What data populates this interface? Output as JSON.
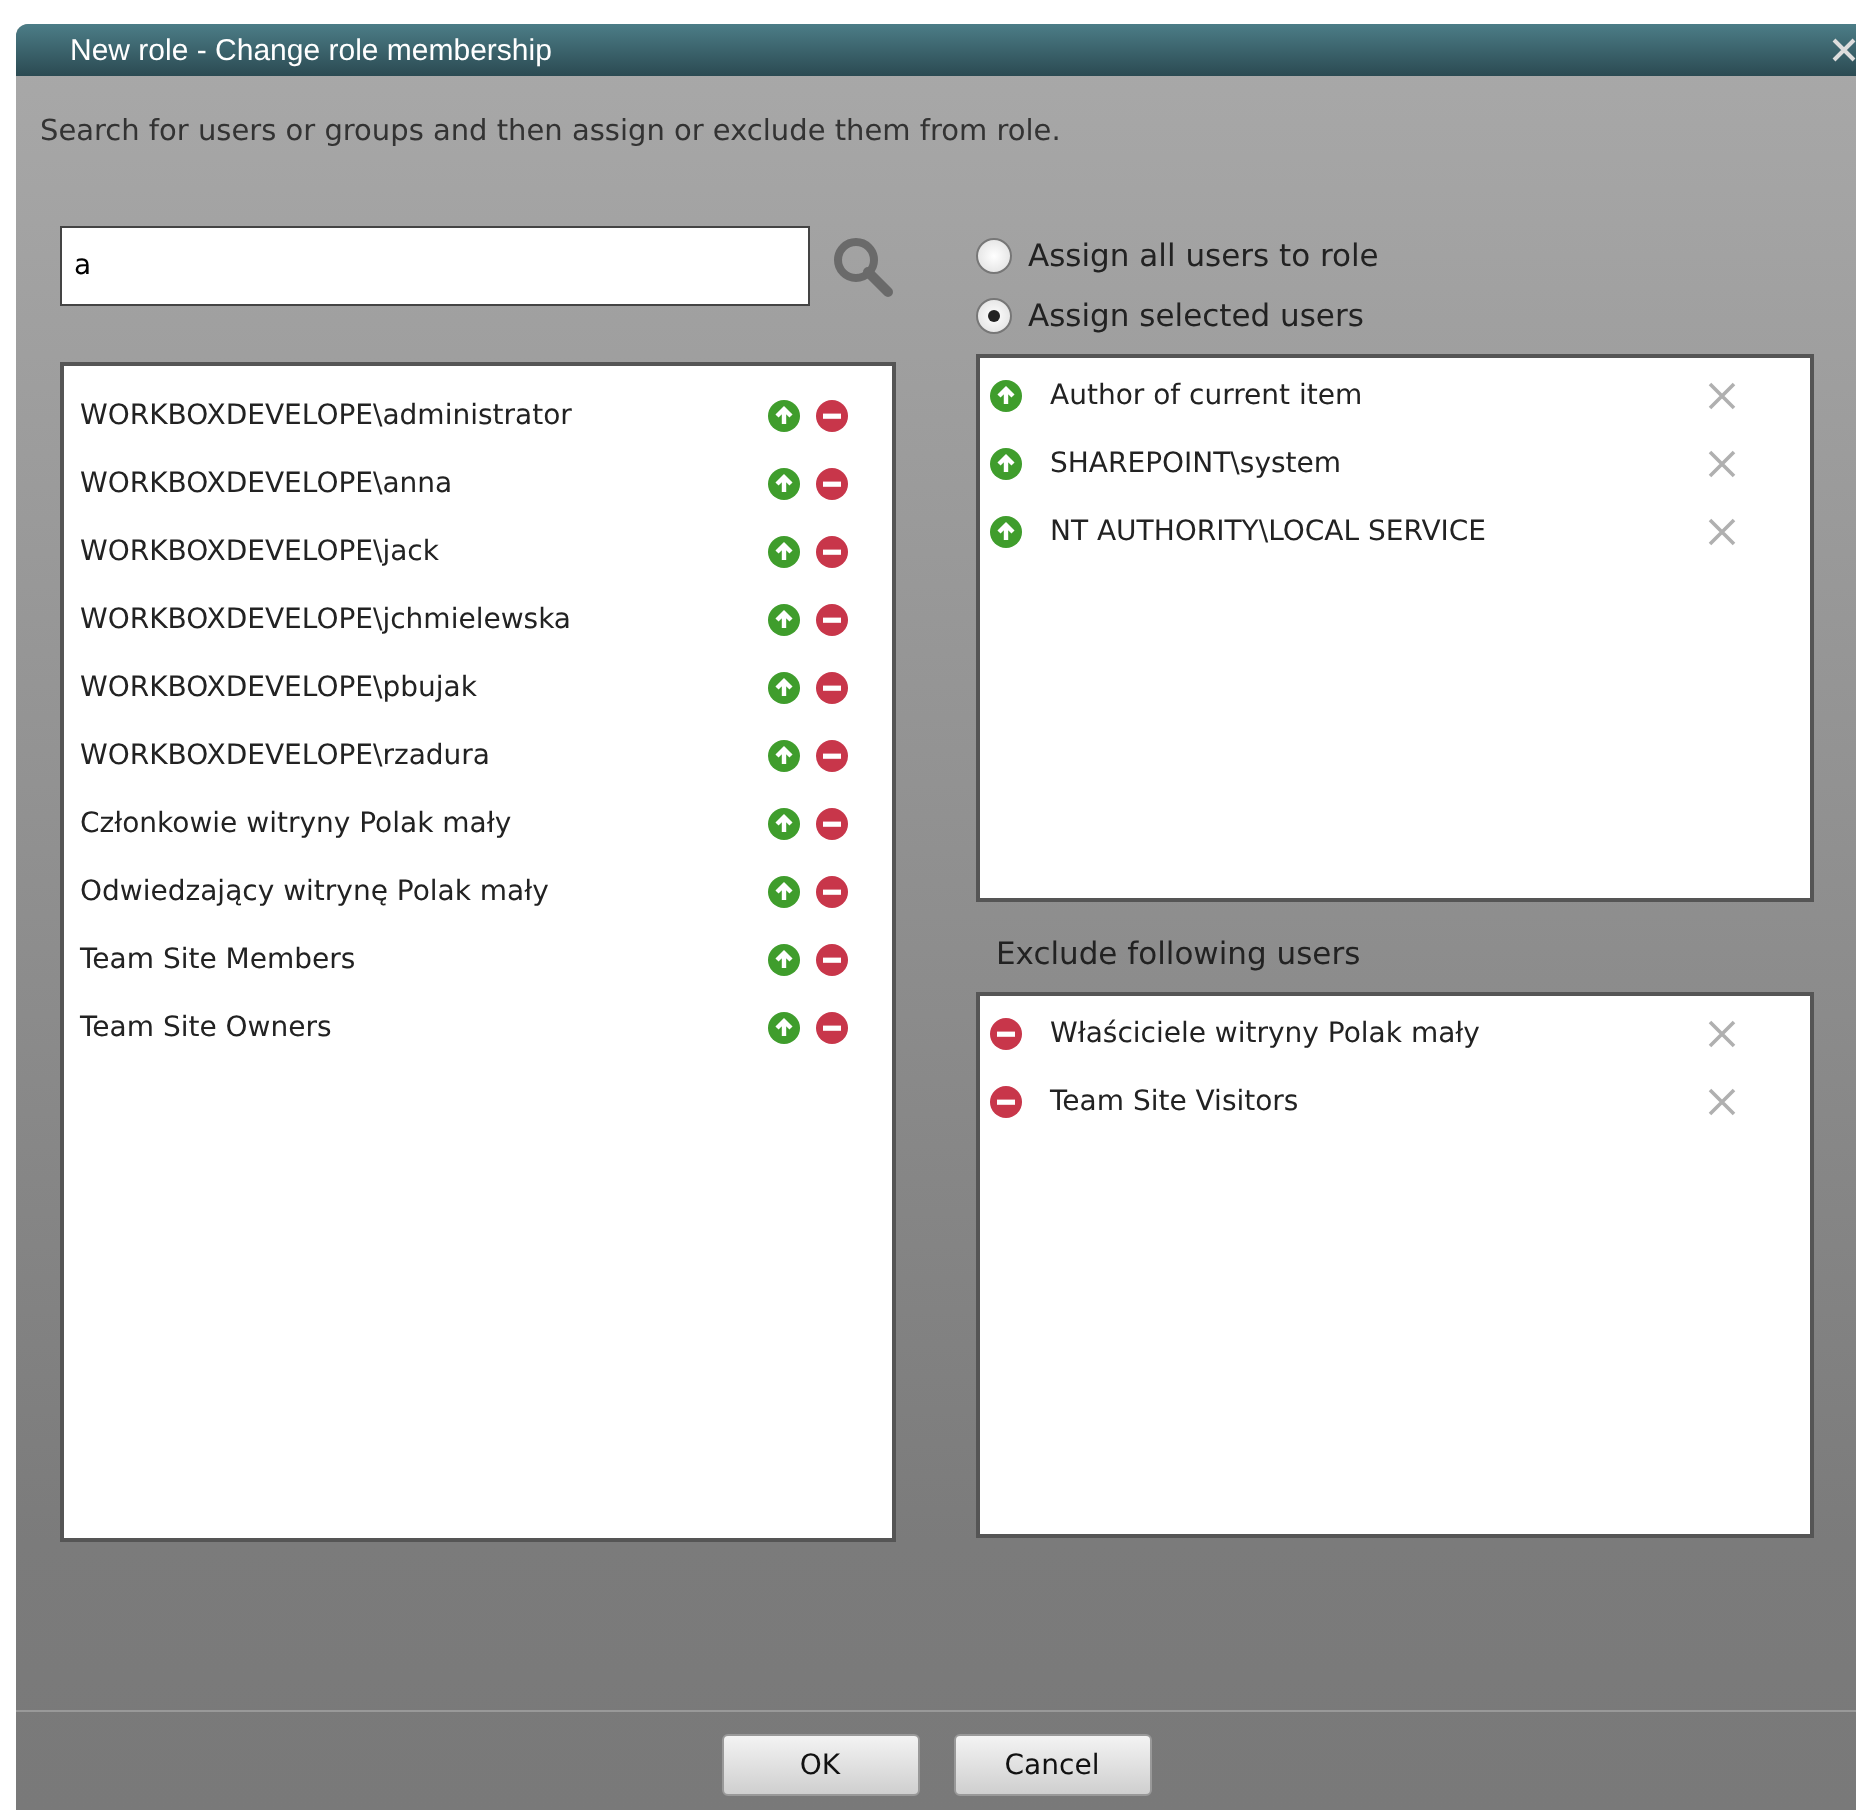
{
  "window": {
    "title": "New role - Change role membership"
  },
  "description": "Search for users or groups and then assign or exclude them from role.",
  "search": {
    "value": "a"
  },
  "results": [
    {
      "name": "WORKBOXDEVELOPE\\administrator"
    },
    {
      "name": "WORKBOXDEVELOPE\\anna"
    },
    {
      "name": "WORKBOXDEVELOPE\\jack"
    },
    {
      "name": "WORKBOXDEVELOPE\\jchmielewska"
    },
    {
      "name": "WORKBOXDEVELOPE\\pbujak"
    },
    {
      "name": "WORKBOXDEVELOPE\\rzadura"
    },
    {
      "name": "Członkowie witryny Polak mały"
    },
    {
      "name": "Odwiedzający witrynę Polak mały"
    },
    {
      "name": "Team Site Members"
    },
    {
      "name": "Team Site Owners"
    }
  ],
  "assign_options": [
    {
      "label": "Assign all users to role",
      "selected": false
    },
    {
      "label": "Assign selected users",
      "selected": true
    }
  ],
  "assigned": [
    {
      "name": "Author of current item"
    },
    {
      "name": "SHAREPOINT\\system"
    },
    {
      "name": "NT AUTHORITY\\LOCAL SERVICE"
    }
  ],
  "exclude_label": "Exclude following users",
  "excluded": [
    {
      "name": "Właściciele witryny Polak mały"
    },
    {
      "name": "Team Site Visitors"
    }
  ],
  "buttons": [
    "OK",
    "Cancel"
  ]
}
